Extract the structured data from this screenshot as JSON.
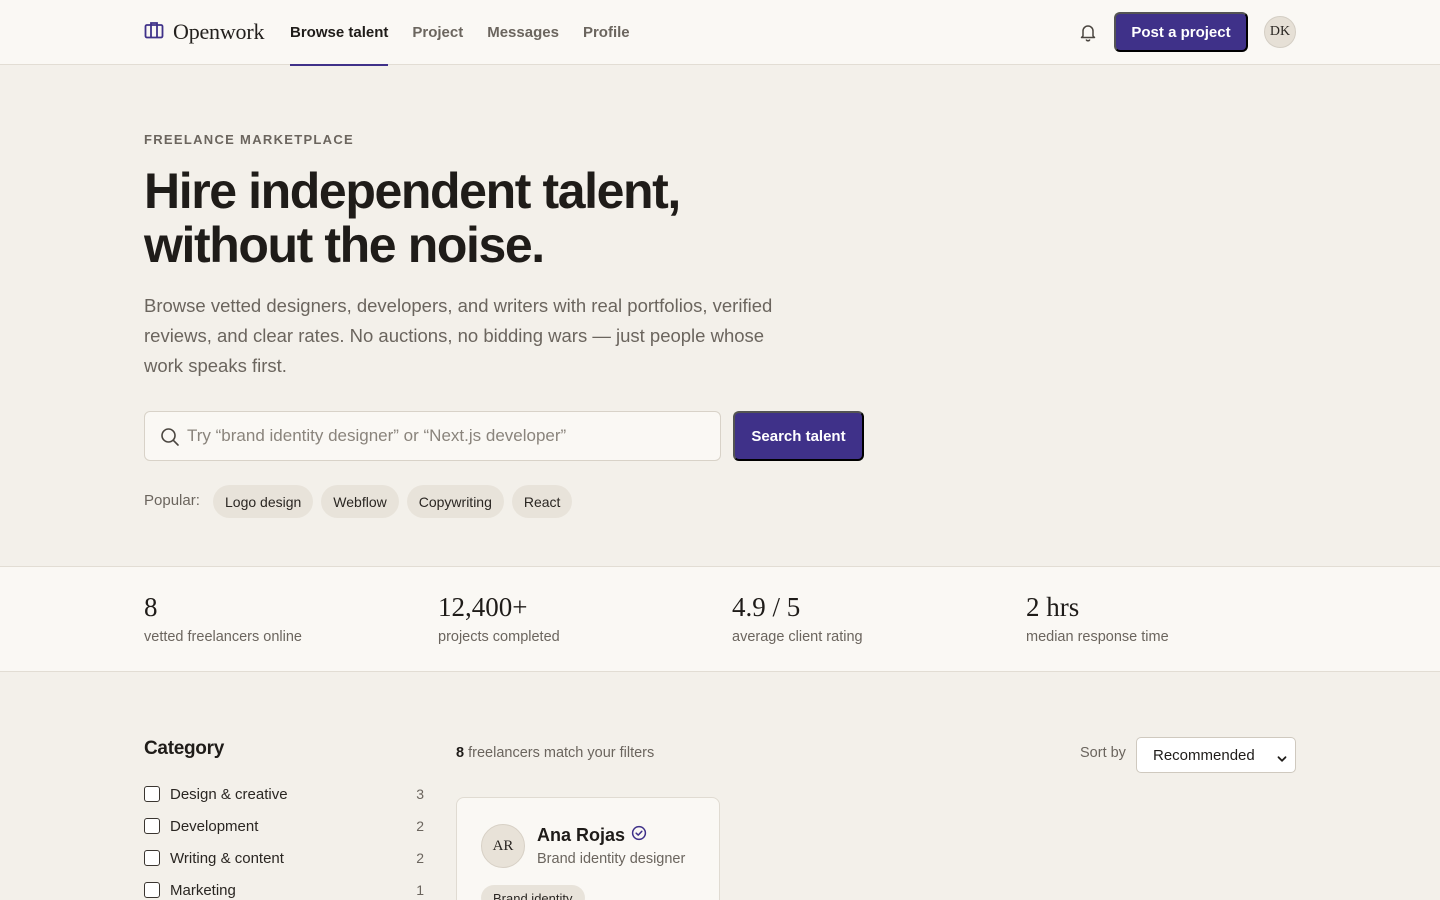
{
  "brand": {
    "name": "Openwork",
    "accent": "#3f3189"
  },
  "nav": {
    "items": [
      {
        "label": "Browse talent",
        "active": true
      },
      {
        "label": "Project"
      },
      {
        "label": "Messages"
      },
      {
        "label": "Profile"
      }
    ],
    "bell_icon": "bell-icon",
    "post_label": "Post a project",
    "avatar_initials": "DK"
  },
  "hero": {
    "eyebrow": "FREELANCE MARKETPLACE",
    "title_line1": "Hire independent talent,",
    "title_line2": "without the noise.",
    "subtitle": "Browse vetted designers, developers, and writers with real portfolios, verified reviews, and clear rates. No auctions, no bidding wars — just people whose work speaks first."
  },
  "search": {
    "placeholder": "Try “brand identity designer” or “Next.js developer”",
    "value": "",
    "button_label": "Search talent",
    "popular_label": "Popular:",
    "popular": [
      "Logo design",
      "Webflow",
      "Copywriting",
      "React"
    ]
  },
  "stats": [
    {
      "value": "8",
      "label": "vetted freelancers online"
    },
    {
      "value": "12,400+",
      "label": "projects completed"
    },
    {
      "value": "4.9 / 5",
      "label": "average client rating"
    },
    {
      "value": "2 hrs",
      "label": "median response time"
    }
  ],
  "filters": {
    "title": "Category",
    "categories": [
      {
        "label": "Design & creative",
        "count": "3",
        "checked": false
      },
      {
        "label": "Development",
        "count": "2",
        "checked": false
      },
      {
        "label": "Writing & content",
        "count": "2",
        "checked": false
      },
      {
        "label": "Marketing",
        "count": "1",
        "checked": false
      }
    ]
  },
  "results": {
    "count": "8",
    "count_suffix": "freelancers match your filters",
    "sort_label": "Sort by",
    "sort_value": "Recommended"
  },
  "cards": [
    {
      "initials": "AR",
      "name": "Ana Rojas",
      "verified_icon": "verified-check-icon",
      "role": "Brand identity designer",
      "tag": "Brand identity"
    }
  ]
}
